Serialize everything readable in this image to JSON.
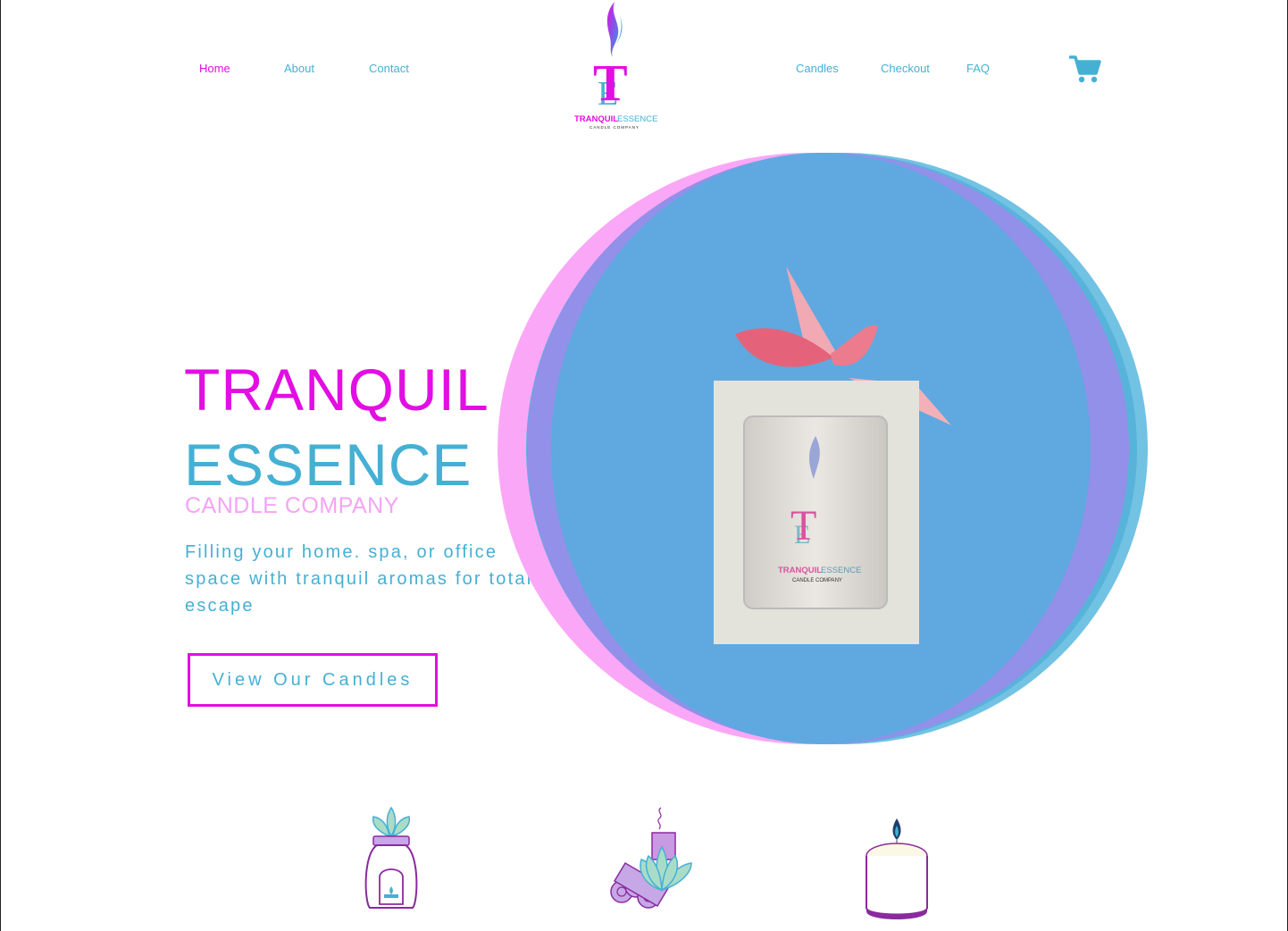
{
  "nav": {
    "left": [
      {
        "label": "Home",
        "active": true
      },
      {
        "label": "About",
        "active": false
      },
      {
        "label": "Contact",
        "active": false
      }
    ],
    "right": [
      {
        "label": "Candles",
        "active": false
      },
      {
        "label": "Checkout",
        "active": false
      },
      {
        "label": "FAQ",
        "active": false
      }
    ],
    "cart_icon": "shopping-cart-icon"
  },
  "logo": {
    "monogram": "TE",
    "brand_part1": "TRANQUIL",
    "brand_part2": "ESSENCE",
    "brand_sub": "CANDLE COMPANY"
  },
  "hero": {
    "line1": "TRANQUIL",
    "line2": "ESSENCE",
    "line3": "CANDLE COMPANY",
    "tagline": "Filling your home. spa, or office space with tranquil aromas for total escape",
    "cta_label": "View Our Candles",
    "product_label_brand1": "TRANQUIL",
    "product_label_brand2": "ESSENCE",
    "product_label_sub": "CANDLE COMPANY"
  },
  "features": [
    {
      "icon": "oil-diffuser-icon"
    },
    {
      "icon": "incense-lotus-icon"
    },
    {
      "icon": "candle-icon"
    }
  ],
  "colors": {
    "magenta": "#e30ee3",
    "teal": "#45b0d4",
    "pink_light": "#f6a3f6",
    "circle_blue": "#5fa9e0",
    "purple": "#8a2a9e"
  }
}
